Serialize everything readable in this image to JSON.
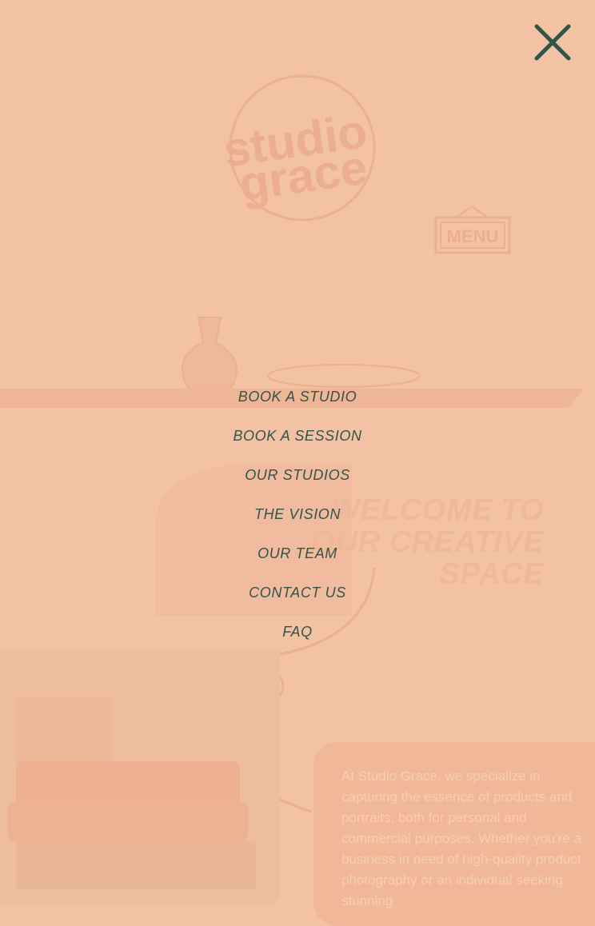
{
  "brand": {
    "logo_line1": "studio",
    "logo_line2": "grace",
    "sign_text": "MENU"
  },
  "background": {
    "headline": "WELCOME TO OUR CREATIVE SPACE",
    "body": "At Studio Grace, we specialize in capturing the essence of products and portraits, both for personal and commercial purposes. Whether you're a business in need of high-quality product photography or an individual seeking stunning"
  },
  "menu": {
    "close_icon": "close-icon",
    "items": [
      {
        "label": "BOOK A STUDIO"
      },
      {
        "label": "BOOK A SESSION"
      },
      {
        "label": "OUR STUDIOS"
      },
      {
        "label": "THE VISION"
      },
      {
        "label": "OUR TEAM"
      },
      {
        "label": "CONTACT US"
      },
      {
        "label": "FAQ"
      }
    ]
  },
  "colors": {
    "overlay": "#f3c1a4",
    "menu_text": "#34544a",
    "close_icon": "#2f5548"
  }
}
